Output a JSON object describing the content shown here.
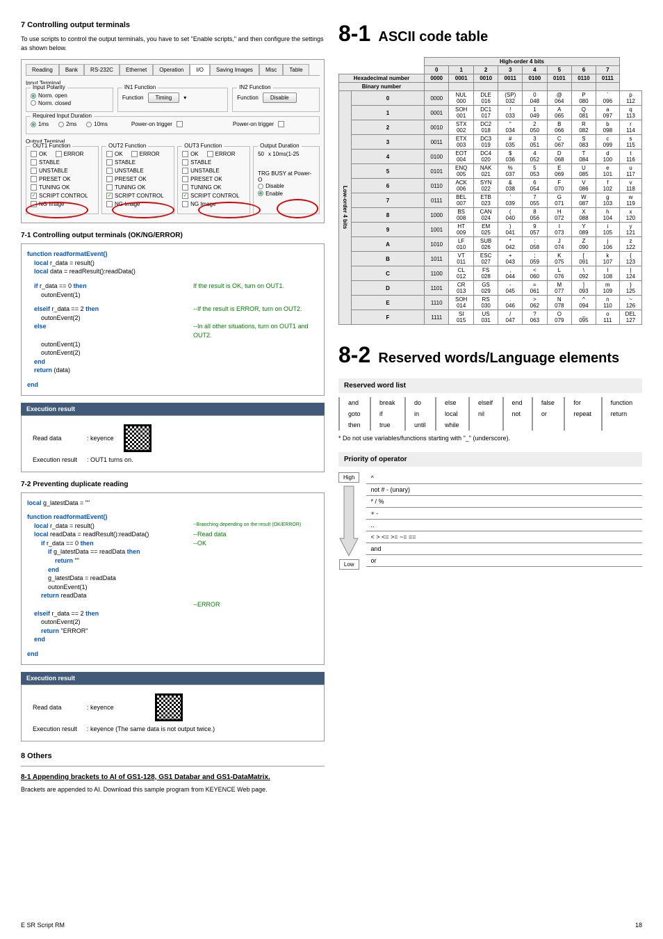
{
  "left": {
    "h7": "7  Controlling output terminals",
    "intro": "To use scripts to control the output terminals, you have to set \"Enable scripts,\" and then configure the settings as shown below.",
    "tabs": [
      "Reading",
      "Bank",
      "RS-232C",
      "Ethernet",
      "Operation",
      "I/O",
      "Saving Images",
      "Misc",
      "Table"
    ],
    "inputTerminal": "Input Terminal",
    "inputPolarity": "Input Polarity",
    "normOpen": "Norm. open",
    "normClosed": "Norm. closed",
    "in1": "IN1 Function",
    "in2": "IN2 Function",
    "func": "Function",
    "timing": "Timing",
    "disable": "Disable",
    "reqDur": "Required Input Duration",
    "d1": "1ms",
    "d2": "2ms",
    "d10": "10ms",
    "pot": "Power-on trigger",
    "outputTerminal": "Output Terminal",
    "out1": "OUT1 Function",
    "out2": "OUT2 Function",
    "out3": "OUT3 Function",
    "outdur": "Output Duration",
    "ok": "OK",
    "error": "ERROR",
    "stable": "STABLE",
    "unstable": "UNSTABLE",
    "preset": "PRESET OK",
    "tuning": "TUNING OK",
    "script": "SCRIPT CONTROL",
    "ngimg": "NG Image",
    "durval": "50",
    "durunit": "x 10ms(1-25",
    "trg": "TRG BUSY at Power-O",
    "rDisable": "Disable",
    "rEnable": "Enable",
    "h71": "7-1    Controlling output terminals (OK/NG/ERROR)",
    "code1": {
      "l1": "function readformatEvent()",
      "l2": "    local r_data = result()",
      "l3": "    local data = readResult():readData()",
      "l4": "    if r_data == 0 then",
      "c4": "If the result is OK, turn on OUT1.",
      "l5": "        outonEvent(1)",
      "l6": "    elseif r_data == 2 then",
      "c6": "--If the result is ERROR, turn on OUT2.",
      "l7": "        outonEvent(2)",
      "l8": "    else",
      "c8": "--In all other situations, turn on OUT1 and OUT2.",
      "l9": "        outonEvent(1)",
      "l10": "        outonEvent(2)",
      "l11": "    end",
      "l12": "    return (data)",
      "l13": "end"
    },
    "execResult": "Execution result",
    "readData": "Read data",
    "keyence": ": keyence",
    "er1": ": OUT1 turns on.",
    "h72": "7-2    Preventing duplicate reading",
    "code2": {
      "l1": "local g_latestData = \"\"",
      "l2": "function readformatEvent()",
      "l3": "    local r_data = result()",
      "c3": "--Branching depending on the result (OK/ERROR)",
      "l4": "    local readData = readResult():readData()",
      "c4": "--Read data",
      "l5": "        if r_data == 0 then",
      "c5": "--OK",
      "l6": "            if g_latestData == readData then",
      "l7": "                return \"\"",
      "l8": "            end",
      "l9": "            g_latestData = readData",
      "l10": "            outonEvent(1)",
      "l11": "        return readData",
      "c11": "--ERROR",
      "l12": "    elseif r_data == 2 then",
      "l13": "        outonEvent(2)",
      "l14": "        return \"ERROR\"",
      "l15": "    end",
      "l16": "end"
    },
    "er2": ": keyence (The same data is not output twice.)",
    "h8": "8  Others",
    "h81": "8-1    Appending brackets to AI of GS1-128, GS1 Databar and GS1-DataMatrix.",
    "p81": "Brackets are appended to AI. Download this sample program from KEYENCE Web page."
  },
  "right": {
    "h81": "ASCII code table",
    "n81": "8-1",
    "ho4": "High-order 4 bits",
    "hex": "Hexadecimal number",
    "bin": "Binary number",
    "lo4": "Low-order 4 bits",
    "cols": [
      "0",
      "1",
      "2",
      "3",
      "4",
      "5",
      "6",
      "7"
    ],
    "colsBin": [
      "0000",
      "0001",
      "0010",
      "0011",
      "0100",
      "0101",
      "0110",
      "0111"
    ],
    "rows": [
      {
        "h": "0",
        "b": "0000",
        "c": [
          [
            "NUL",
            "000"
          ],
          [
            "DLE",
            "016"
          ],
          [
            "(SP)",
            "032"
          ],
          [
            "0",
            "048"
          ],
          [
            "@",
            "064"
          ],
          [
            "P",
            "080"
          ],
          [
            "`",
            "096"
          ],
          [
            "p",
            "112"
          ]
        ]
      },
      {
        "h": "1",
        "b": "0001",
        "c": [
          [
            "SOH",
            "001"
          ],
          [
            "DC1",
            "017"
          ],
          [
            "!",
            "033"
          ],
          [
            "1",
            "049"
          ],
          [
            "A",
            "065"
          ],
          [
            "Q",
            "081"
          ],
          [
            "a",
            "097"
          ],
          [
            "q",
            "113"
          ]
        ]
      },
      {
        "h": "2",
        "b": "0010",
        "c": [
          [
            "STX",
            "002"
          ],
          [
            "DC2",
            "018"
          ],
          [
            "\"",
            "034"
          ],
          [
            "2",
            "050"
          ],
          [
            "B",
            "066"
          ],
          [
            "R",
            "082"
          ],
          [
            "b",
            "098"
          ],
          [
            "r",
            "114"
          ]
        ]
      },
      {
        "h": "3",
        "b": "0011",
        "c": [
          [
            "ETX",
            "003"
          ],
          [
            "DC3",
            "019"
          ],
          [
            "#",
            "035"
          ],
          [
            "3",
            "051"
          ],
          [
            "C",
            "067"
          ],
          [
            "S",
            "083"
          ],
          [
            "c",
            "099"
          ],
          [
            "s",
            "115"
          ]
        ]
      },
      {
        "h": "4",
        "b": "0100",
        "c": [
          [
            "EOT",
            "004"
          ],
          [
            "DC4",
            "020"
          ],
          [
            "$",
            "036"
          ],
          [
            "4",
            "052"
          ],
          [
            "D",
            "068"
          ],
          [
            "T",
            "084"
          ],
          [
            "d",
            "100"
          ],
          [
            "t",
            "116"
          ]
        ]
      },
      {
        "h": "5",
        "b": "0101",
        "c": [
          [
            "ENQ",
            "005"
          ],
          [
            "NAK",
            "021"
          ],
          [
            "%",
            "037"
          ],
          [
            "5",
            "053"
          ],
          [
            "E",
            "069"
          ],
          [
            "U",
            "085"
          ],
          [
            "e",
            "101"
          ],
          [
            "u",
            "117"
          ]
        ]
      },
      {
        "h": "6",
        "b": "0110",
        "c": [
          [
            "ACK",
            "006"
          ],
          [
            "SYN",
            "022"
          ],
          [
            "&",
            "038"
          ],
          [
            "6",
            "054"
          ],
          [
            "F",
            "070"
          ],
          [
            "V",
            "086"
          ],
          [
            "f",
            "102"
          ],
          [
            "v",
            "118"
          ]
        ]
      },
      {
        "h": "7",
        "b": "0111",
        "c": [
          [
            "BEL",
            "007"
          ],
          [
            "ETB",
            "023"
          ],
          [
            "'",
            "039"
          ],
          [
            "7",
            "055"
          ],
          [
            "G",
            "071"
          ],
          [
            "W",
            "087"
          ],
          [
            "g",
            "103"
          ],
          [
            "w",
            "119"
          ]
        ]
      },
      {
        "h": "8",
        "b": "1000",
        "c": [
          [
            "BS",
            "008"
          ],
          [
            "CAN",
            "024"
          ],
          [
            "(",
            "040"
          ],
          [
            "8",
            "056"
          ],
          [
            "H",
            "072"
          ],
          [
            "X",
            "088"
          ],
          [
            "h",
            "104"
          ],
          [
            "x",
            "120"
          ]
        ]
      },
      {
        "h": "9",
        "b": "1001",
        "c": [
          [
            "HT",
            "009"
          ],
          [
            "EM",
            "025"
          ],
          [
            ")",
            "041"
          ],
          [
            "9",
            "057"
          ],
          [
            "I",
            "073"
          ],
          [
            "Y",
            "089"
          ],
          [
            "i",
            "105"
          ],
          [
            "y",
            "121"
          ]
        ]
      },
      {
        "h": "A",
        "b": "1010",
        "c": [
          [
            "LF",
            "010"
          ],
          [
            "SUB",
            "026"
          ],
          [
            "*",
            "042"
          ],
          [
            ":",
            "058"
          ],
          [
            "J",
            "074"
          ],
          [
            "Z",
            "090"
          ],
          [
            "j",
            "106"
          ],
          [
            "z",
            "122"
          ]
        ]
      },
      {
        "h": "B",
        "b": "1011",
        "c": [
          [
            "VT",
            "011"
          ],
          [
            "ESC",
            "027"
          ],
          [
            "+",
            "043"
          ],
          [
            ";",
            "059"
          ],
          [
            "K",
            "075"
          ],
          [
            "[",
            "091"
          ],
          [
            "k",
            "107"
          ],
          [
            "{",
            "123"
          ]
        ]
      },
      {
        "h": "C",
        "b": "1100",
        "c": [
          [
            "CL",
            "012"
          ],
          [
            "FS",
            "028"
          ],
          [
            ",",
            "044"
          ],
          [
            "<",
            "060"
          ],
          [
            "L",
            "076"
          ],
          [
            "\\",
            "092"
          ],
          [
            "l",
            "108"
          ],
          [
            "|",
            "124"
          ]
        ]
      },
      {
        "h": "D",
        "b": "1101",
        "c": [
          [
            "CR",
            "013"
          ],
          [
            "GS",
            "029"
          ],
          [
            "-",
            "045"
          ],
          [
            "=",
            "061"
          ],
          [
            "M",
            "077"
          ],
          [
            "]",
            "093"
          ],
          [
            "m",
            "109"
          ],
          [
            "}",
            "125"
          ]
        ]
      },
      {
        "h": "E",
        "b": "1110",
        "c": [
          [
            "SOH",
            "014"
          ],
          [
            "RS",
            "030"
          ],
          [
            ".",
            "046"
          ],
          [
            ">",
            "062"
          ],
          [
            "N",
            "078"
          ],
          [
            "^",
            "094"
          ],
          [
            "n",
            "110"
          ],
          [
            "~",
            "126"
          ]
        ]
      },
      {
        "h": "F",
        "b": "1111",
        "c": [
          [
            "SI",
            "015"
          ],
          [
            "US",
            "031"
          ],
          [
            "/",
            "047"
          ],
          [
            "?",
            "063"
          ],
          [
            "O",
            "079"
          ],
          [
            "_",
            "095"
          ],
          [
            "o",
            "111"
          ],
          [
            "DEL",
            "127"
          ]
        ]
      }
    ],
    "h82": "Reserved words/Language elements",
    "n82": "8-2",
    "rwl": "Reserved word list",
    "words": [
      [
        "and",
        "break",
        "do",
        "else",
        "elseif",
        "end",
        "false",
        "for",
        "function"
      ],
      [
        "goto",
        "if",
        "in",
        "local",
        "nil",
        "not",
        "or",
        "repeat",
        "return"
      ],
      [
        "then",
        "true",
        "until",
        "while",
        "",
        "",
        "",
        "",
        ""
      ]
    ],
    "note": "*  Do not use variables/functions starting with \"_\" (underscore).",
    "pop": "Priority of operator",
    "high": "High",
    "low": "Low",
    "ops": [
      "^",
      "not   #    - (unary)",
      "*    /    %",
      "+    -",
      "..",
      "<   >   <=   >=   ~=   ==",
      "and",
      "or"
    ]
  },
  "footer": {
    "left": "E SR Script RM",
    "page": "18"
  }
}
